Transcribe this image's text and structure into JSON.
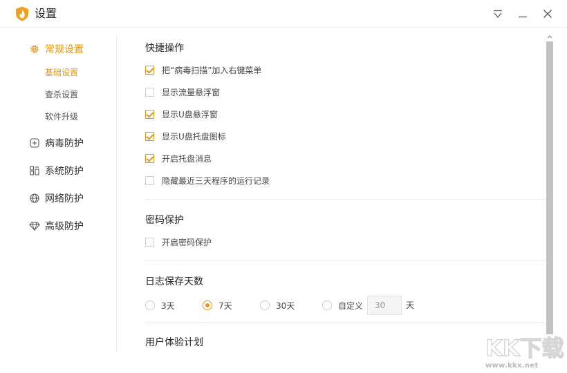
{
  "window": {
    "title": "设置",
    "icons": {
      "logo": "flame-shield-logo",
      "menu": "dropdown-menu-icon",
      "minimize": "minimize-icon",
      "close": "close-icon"
    }
  },
  "colors": {
    "accent": "#e8951a",
    "text": "#333333",
    "divider": "#ececec",
    "scrollbar": "#c2c2c2"
  },
  "sidebar": {
    "groups": [
      {
        "label": "常规设置",
        "icon": "gear-icon",
        "active": true,
        "items": [
          {
            "label": "基础设置",
            "active": true
          },
          {
            "label": "查杀设置",
            "active": false
          },
          {
            "label": "软件升级",
            "active": false
          }
        ]
      },
      {
        "label": "病毒防护",
        "icon": "plus-square-icon"
      },
      {
        "label": "系统防护",
        "icon": "system-grid-icon"
      },
      {
        "label": "网络防护",
        "icon": "globe-icon"
      },
      {
        "label": "高级防护",
        "icon": "diamond-icon"
      }
    ]
  },
  "content": {
    "quick": {
      "title": "快捷操作",
      "options": [
        {
          "label": "把“病毒扫描”加入右键菜单",
          "checked": true
        },
        {
          "label": "显示流量悬浮窗",
          "checked": false
        },
        {
          "label": "显示U盘悬浮窗",
          "checked": true
        },
        {
          "label": "显示U盘托盘图标",
          "checked": true
        },
        {
          "label": "开启托盘消息",
          "checked": true
        },
        {
          "label": "隐藏最近三天程序的运行记录",
          "checked": false
        }
      ]
    },
    "password": {
      "title": "密码保护",
      "options": [
        {
          "label": "开启密码保护",
          "checked": false
        }
      ]
    },
    "log": {
      "title": "日志保存天数",
      "options": [
        {
          "label": "3天",
          "checked": false
        },
        {
          "label": "7天",
          "checked": true
        },
        {
          "label": "30天",
          "checked": false
        },
        {
          "label": "自定义",
          "checked": false
        }
      ],
      "custom_value": "30",
      "unit": "天"
    },
    "experience": {
      "title": "用户体验计划"
    }
  },
  "watermark": {
    "logo_text": "KK下载",
    "url": "www.kkx.net"
  }
}
